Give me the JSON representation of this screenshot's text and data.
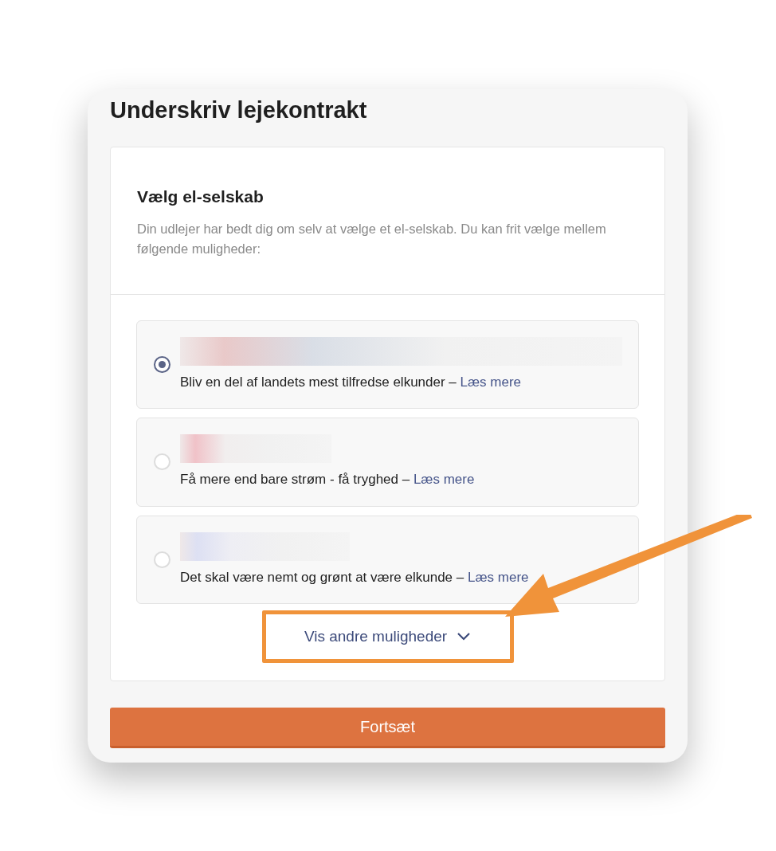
{
  "title": "Underskriv lejekontrakt",
  "section": {
    "title": "Vælg el-selskab",
    "description": "Din udlejer har bedt dig om selv at vælge et el-selskab. Du kan frit vælge mellem følgende muligheder:"
  },
  "options": [
    {
      "text": "Bliv en del af landets mest tilfredse elkunder –",
      "link": "Læs mere",
      "selected": true
    },
    {
      "text": "Få mere end bare strøm - få tryghed –",
      "link": "Læs mere",
      "selected": false
    },
    {
      "text": "Det skal være nemt og grønt at være elkunde –",
      "link": "Læs mere",
      "selected": false
    }
  ],
  "show_more": {
    "label": "Vis andre muligheder",
    "highlighted": true
  },
  "continue_button": "Fortsæt"
}
